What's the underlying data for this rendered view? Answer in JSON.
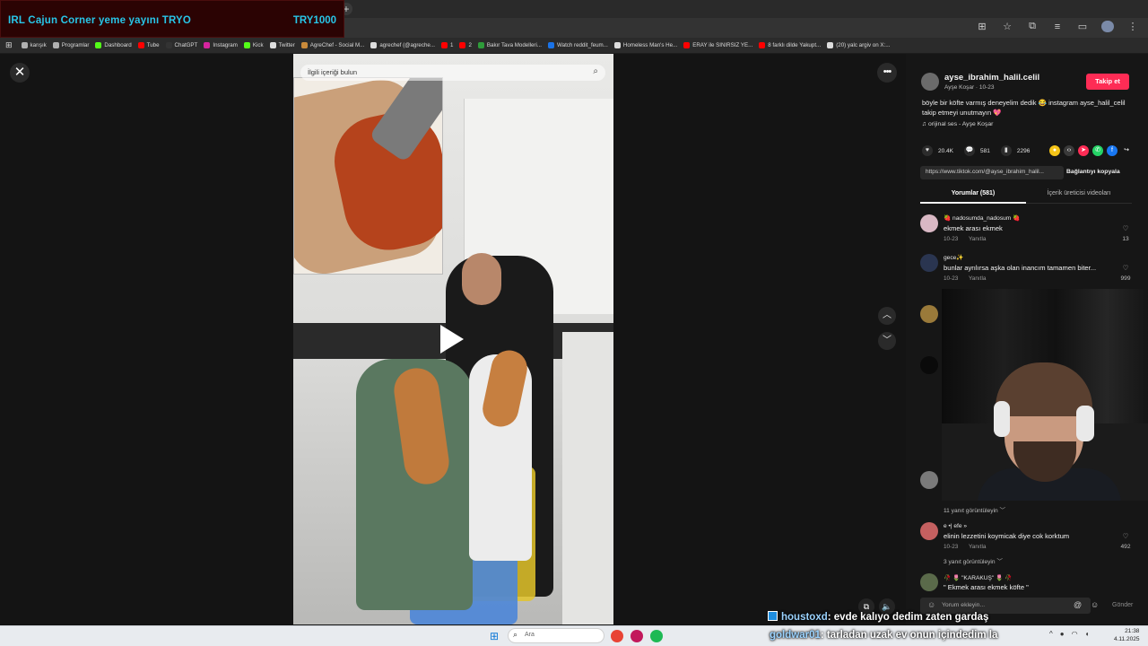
{
  "banner": {
    "title": "IRL Cajun Corner yeme yayını  TRYO",
    "right": "TRY1000"
  },
  "browser": {
    "new_tab": "+",
    "toolbar_icons": [
      "install-icon",
      "star-icon",
      "extensions-icon",
      "media-icon",
      "sidebar-icon",
      "profile-icon",
      "menu-icon"
    ],
    "bookmarks": [
      {
        "label": "karışık",
        "color": "#b0b0b0"
      },
      {
        "label": "Programlar",
        "color": "#b0b0b0"
      },
      {
        "label": "Dashboard",
        "color": "#53fc18"
      },
      {
        "label": "Tube",
        "color": "#ff0000"
      },
      {
        "label": "ChatGPT",
        "color": "#333333"
      },
      {
        "label": "Instagram",
        "color": "#d6249f"
      },
      {
        "label": "Kick",
        "color": "#53fc18"
      },
      {
        "label": "Twitter",
        "color": "#dddddd"
      },
      {
        "label": "AgreChef - Social M...",
        "color": "#c98a3a"
      },
      {
        "label": "agrechef (@agreche...",
        "color": "#dddddd"
      },
      {
        "label": "1",
        "color": "#ff0000"
      },
      {
        "label": "2",
        "color": "#ff0000"
      },
      {
        "label": "Bakır Tava Modelleri...",
        "color": "#2e9c3a"
      },
      {
        "label": "Watch reddit_feum...",
        "color": "#1a73e8"
      },
      {
        "label": "Homeless Man's He...",
        "color": "#dddddd"
      },
      {
        "label": "ERAY ile SINIRSIZ YE...",
        "color": "#ff0000"
      },
      {
        "label": "8 farklı dilde Yakupt...",
        "color": "#ff0000"
      },
      {
        "label": "(20) yalc argiv on X:...",
        "color": "#dddddd"
      }
    ]
  },
  "viewer": {
    "close": "✕",
    "more": "•••",
    "nav_up": "︿",
    "nav_down": "﹀",
    "search_placeholder": "İlgili içeriği bulun",
    "video_buttons": [
      "pip-icon",
      "volume-icon"
    ]
  },
  "post": {
    "username": "ayse_ibrahim_halil.celil",
    "subline": "Ayşe Koşar · 10-23",
    "follow": "Takip et",
    "description": "böyle bir köfte varmış deneyelim dedik 😂 instagram ayse_halil_celil takip etmeyi unutmayın 💖",
    "sound": "♫  orijinal ses - Ayşe Koşar",
    "likes": "20.4K",
    "comments": "581",
    "saves": "2296",
    "link": "https://www.tiktok.com/@ayse_ibrahim_halil...",
    "copy_link": "Bağlantıyı kopyala",
    "tabs": [
      "Yorumlar (581)",
      "İçerik üreticisi videoları"
    ]
  },
  "comments": [
    {
      "name": "🍓 nadosumda_nadosum 🍓",
      "text": "ekmek arası ekmek",
      "date": "10-23",
      "reply": "Yanıtla",
      "likes": "13",
      "avatar": "#d9b8c4"
    },
    {
      "name": "gece✨",
      "text": "bunlar ayrılırsa aşka olan inancım tamamen biter...",
      "date": "10-23",
      "reply": "Yanıtla",
      "likes": "999",
      "avatar": "#2a3550"
    },
    {
      "name": "e •| efe »",
      "text": "elinin lezzetini koymicak diye cok korktum",
      "date": "10-23",
      "reply": "Yanıtla",
      "likes": "492",
      "avatar": "#c46060"
    },
    {
      "name": "🥀 🌷 \"KARAKUŞ\" 🌷 🥀",
      "text": "\" Ekmek arası ekmek köfte \"",
      "date": "",
      "reply": "",
      "likes": "",
      "avatar": "#5a6a4a"
    }
  ],
  "replies": {
    "r1": "11 yanıt görüntüleyin ﹀",
    "r2": "3 yanıt görüntüleyin ﹀"
  },
  "comment_input": {
    "placeholder": "Yorum ekleyin...",
    "send": "Gönder"
  },
  "chat": [
    {
      "user": "houstoxd",
      "text": ": evde kalıyo dedim zaten gardaş"
    },
    {
      "user": "goldwar01",
      "text": ": tarladan uzak ev onun içindedim la"
    }
  ],
  "taskbar": {
    "search_placeholder": "Ara",
    "time": "21:38",
    "date": "4.11.2025",
    "apps": [
      {
        "name": "chrome",
        "color": "#e84335"
      },
      {
        "name": "app2",
        "color": "#c2185b"
      },
      {
        "name": "spotify",
        "color": "#1db954"
      }
    ]
  }
}
